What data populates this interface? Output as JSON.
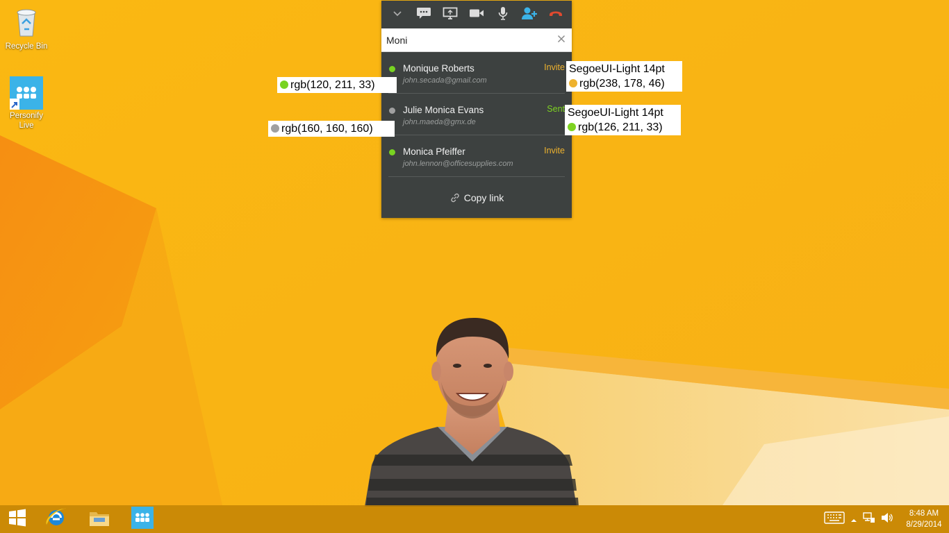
{
  "desktop": {
    "icons": [
      {
        "label": "Recycle Bin",
        "icon": "recycle-bin-icon"
      },
      {
        "label": "Personify Live",
        "icon": "personify-live-icon"
      }
    ]
  },
  "panel": {
    "toolbar": [
      {
        "icon": "chevron-down-icon"
      },
      {
        "icon": "chat-icon"
      },
      {
        "icon": "screen-share-icon"
      },
      {
        "icon": "video-camera-icon"
      },
      {
        "icon": "microphone-icon"
      },
      {
        "icon": "add-person-icon"
      },
      {
        "icon": "hang-up-icon"
      }
    ],
    "search": {
      "value": "Moni"
    },
    "contacts": [
      {
        "name": "Monique Roberts",
        "email": "john.secada@gmail.com",
        "status_color": "#78d321",
        "action": "Invite",
        "action_color": "#eeb22e"
      },
      {
        "name": "Julie Monica Evans",
        "email": "john.maeda@gmx.de",
        "status_color": "#a0a0a0",
        "action": "Sent",
        "action_color": "#7ed321"
      },
      {
        "name": "Monica Pfeiffer",
        "email": "john.lennon@officesupplies.com",
        "status_color": "#78d321",
        "action": "Invite",
        "action_color": "#eeb22e"
      }
    ],
    "copy_link_label": "Copy link"
  },
  "annotations": {
    "green_dot": "rgb(120, 211, 33)",
    "grey_dot": "rgb(160, 160, 160)",
    "invite_font": "SegoeUI-Light 14pt",
    "invite_color": "rgb(238, 178, 46)",
    "sent_font": "SegoeUI-Light 14pt",
    "sent_color": "rgb(126, 211, 33)"
  },
  "taskbar": {
    "apps": [
      {
        "icon": "windows-start-icon"
      },
      {
        "icon": "internet-explorer-icon"
      },
      {
        "icon": "file-explorer-icon"
      },
      {
        "icon": "personify-live-icon"
      }
    ],
    "tray": [
      {
        "icon": "keyboard-icon"
      },
      {
        "icon": "chevron-up-icon"
      },
      {
        "icon": "network-icon"
      },
      {
        "icon": "volume-icon"
      }
    ],
    "time": "8:48 AM",
    "date": "8/29/2014"
  },
  "colors": {
    "panel_bg": "#3d4140",
    "wallpaper": "#f9b311",
    "accent_blue": "#3bb3e8",
    "hangup_red": "#e04a2f"
  }
}
